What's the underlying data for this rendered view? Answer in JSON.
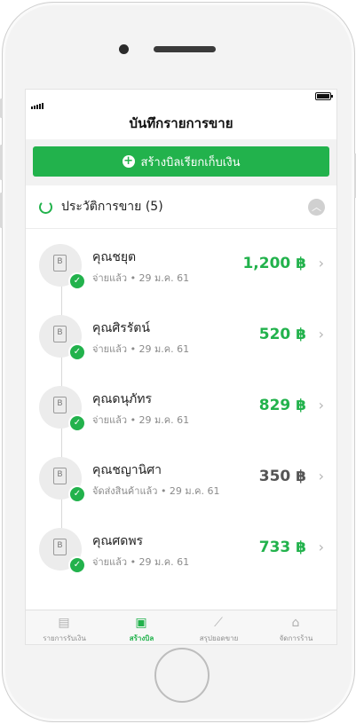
{
  "header": {
    "title": "บันทึกรายการขาย"
  },
  "create_button": {
    "label": "สร้างบิลเรียกเก็บเงิน",
    "icon": "plus-circle-icon"
  },
  "history": {
    "label": "ประวัติการขาย (5)"
  },
  "sales": [
    {
      "name": "คุณชยุต",
      "status": "จ่ายแล้ว • 29 ม.ค. 61",
      "amount": "1,200 ฿",
      "state": "paid"
    },
    {
      "name": "คุณศิรรัตน์",
      "status": "จ่ายแล้ว • 29 ม.ค. 61",
      "amount": "520 ฿",
      "state": "paid"
    },
    {
      "name": "คุณดนุภัทร",
      "status": "จ่ายแล้ว • 29 ม.ค. 61",
      "amount": "829 ฿",
      "state": "paid"
    },
    {
      "name": "คุณชญานิศา",
      "status": "จัดส่งสินค้าแล้ว • 29 ม.ค. 61",
      "amount": "350 ฿",
      "state": "shipped"
    },
    {
      "name": "คุณศดพร",
      "status": "จ่ายแล้ว • 29 ม.ค. 61",
      "amount": "733 ฿",
      "state": "paid"
    }
  ],
  "tabs": [
    {
      "label": "รายการรับเงิน",
      "icon": "clipboard-icon"
    },
    {
      "label": "สร้างบิล",
      "icon": "bill-icon"
    },
    {
      "label": "สรุปยอดขาย",
      "icon": "line-chart-icon"
    },
    {
      "label": "จัดการร้าน",
      "icon": "store-icon"
    }
  ],
  "colors": {
    "accent": "#22b24c",
    "muted": "#8b8b8b"
  }
}
